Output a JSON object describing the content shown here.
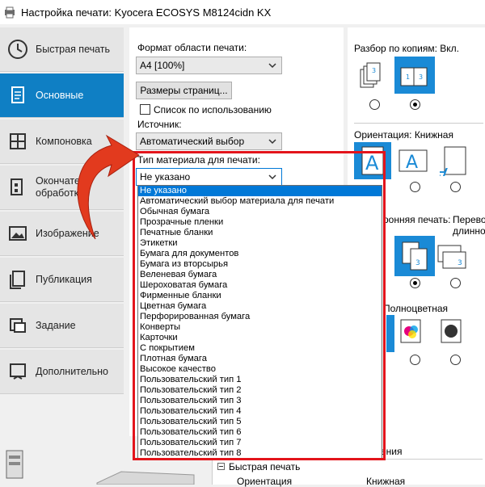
{
  "window": {
    "title": "Настройка печати: Kyocera ECOSYS M8124cidn KX"
  },
  "sidebar": {
    "items": [
      {
        "label": "Быстрая печать",
        "icon": "clock-icon",
        "active": false
      },
      {
        "label": "Основные",
        "icon": "document-icon",
        "active": true
      },
      {
        "label": "Компоновка",
        "icon": "layout-grid-icon",
        "active": false
      },
      {
        "label": "Окончательная обработка",
        "label_line1": "Окончател",
        "label_line2": "обработк",
        "icon": "finishing-icon",
        "active": false
      },
      {
        "label": "Изображение",
        "icon": "image-icon",
        "active": false
      },
      {
        "label": "Публикация",
        "icon": "publication-icon",
        "active": false
      },
      {
        "label": "Задание",
        "icon": "job-icon",
        "active": false
      },
      {
        "label": "Дополнительно",
        "icon": "advanced-icon",
        "active": false
      }
    ]
  },
  "main": {
    "print_area_label": "Формат области печати:",
    "print_area_value": "A4  [100%]",
    "page_sizes_button": "Размеры страниц...",
    "use_list_checkbox": "Список по использованию",
    "source_label": "Источник:",
    "source_value": "Автоматический выбор",
    "media_type_label": "Тип материала для печати:",
    "media_type_value": "Не указано"
  },
  "media_dropdown": {
    "selected_index": 0,
    "options": [
      "Не указано",
      "Автоматический выбор материала для печати",
      "Обычная бумага",
      "Прозрачные пленки",
      "Печатные бланки",
      "Этикетки",
      "Бумага для документов",
      "Бумага из вторсырья",
      "Веленевая бумага",
      "Шероховатая бумага",
      "Фирменные бланки",
      "Цветная бумага",
      "Перфорированная бумага",
      "Конверты",
      "Карточки",
      "С покрытием",
      "Плотная бумага",
      "Высокое качество",
      "Пользовательский тип 1",
      "Пользовательский тип 2",
      "Пользовательский тип 3",
      "Пользовательский тип 4",
      "Пользовательский тип 5",
      "Пользовательский тип 6",
      "Пользовательский тип 7",
      "Пользовательский тип 8"
    ]
  },
  "right_panel": {
    "collate_label": "Разбор по копиям:",
    "collate_value": "Вкл.",
    "orientation_label": "Ориентация:",
    "orientation_value": "Книжная",
    "duplex_label": "ронняя печать:",
    "duplex_value_line1": "Перевор",
    "duplex_value_line2": "длинной",
    "color_label": "Полноцветная"
  },
  "bottom": {
    "header_text": "ения",
    "tree_item": "Быстрая печать",
    "col_orientation": "Ориентация",
    "col_value": "Книжная"
  },
  "colors": {
    "accent": "#0f7fc4",
    "highlight_box": "#e3141b",
    "dropdown_selection": "#0078d7"
  }
}
